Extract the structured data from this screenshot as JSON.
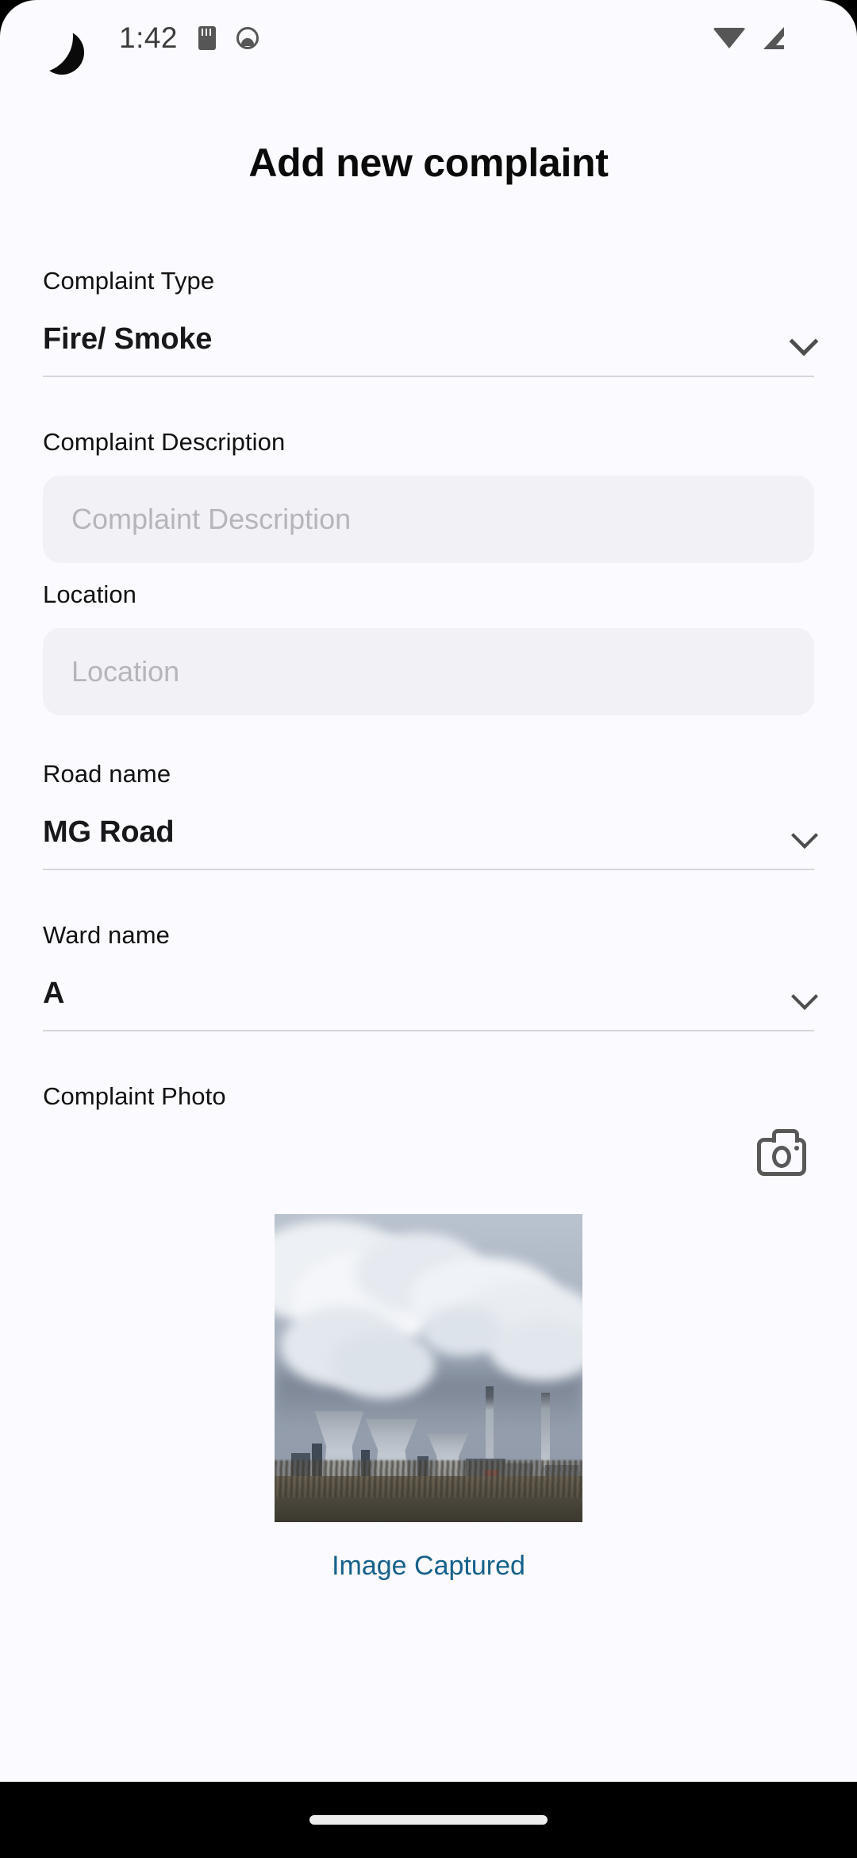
{
  "status_bar": {
    "time": "1:42",
    "left_icons": [
      "sd-card-icon",
      "app-notification-icon"
    ],
    "right_icons": [
      "wifi-icon",
      "cellular-signal-icon",
      "battery-icon"
    ]
  },
  "screen": {
    "title": "Add new complaint"
  },
  "form": {
    "complaint_type": {
      "label": "Complaint Type",
      "value": "Fire/ Smoke"
    },
    "complaint_description": {
      "label": "Complaint Description",
      "value": "",
      "placeholder": "Complaint Description"
    },
    "location": {
      "label": "Location",
      "value": "",
      "placeholder": "Location"
    },
    "road_name": {
      "label": "Road name",
      "value": "MG Road"
    },
    "ward_name": {
      "label": "Ward name",
      "value": "A"
    },
    "complaint_photo": {
      "label": "Complaint Photo",
      "camera_icon": "camera-icon",
      "caption": "Image Captured",
      "caption_color": "#15618C",
      "photo_description": "Power plant with cooling towers and smokestacks emitting white smoke plumes against a grey sky"
    }
  },
  "navigation_bar": {
    "gesture_handle": "home-gesture-pill"
  },
  "colors": {
    "page_background": "#FBFAFE",
    "input_fill": "#F2F1F5",
    "placeholder_text": "#B7B5BC",
    "underline": "#D7D5DC",
    "primary_text": "#111111",
    "link": "#15618C",
    "nav_bar": "#000000"
  }
}
